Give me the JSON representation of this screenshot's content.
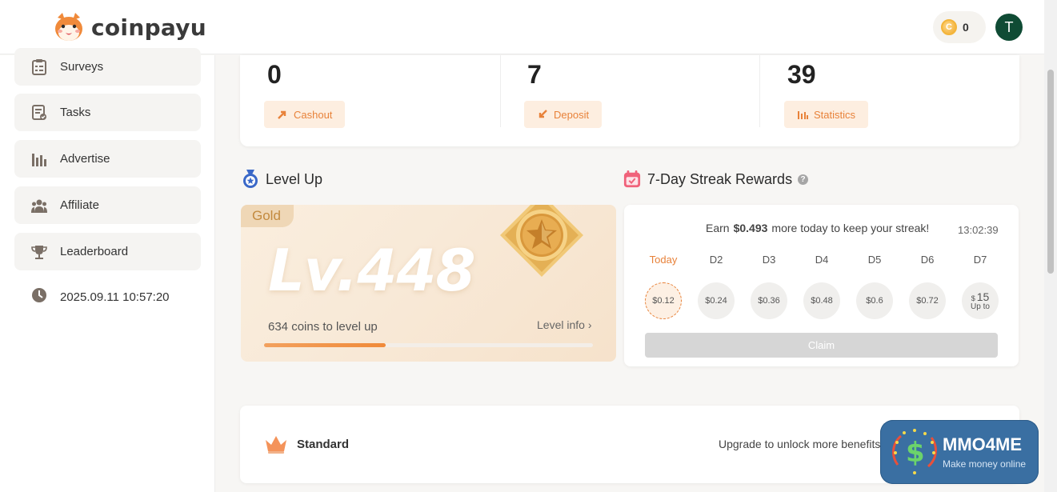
{
  "app": {
    "brand": "coinpayu"
  },
  "header": {
    "coin_symbol": "C",
    "coin_balance": "0",
    "avatar_initial": "T"
  },
  "sidebar": {
    "items": [
      {
        "label": "Surveys",
        "icon": "clipboard-icon"
      },
      {
        "label": "Tasks",
        "icon": "tasks-icon"
      },
      {
        "label": "Advertise",
        "icon": "bar-chart-icon"
      },
      {
        "label": "Affiliate",
        "icon": "users-icon"
      },
      {
        "label": "Leaderboard",
        "icon": "trophy-icon"
      }
    ],
    "datetime": "2025.09.11 10:57:20"
  },
  "stats": [
    {
      "value": "0",
      "button": "Cashout"
    },
    {
      "value": "7",
      "button": "Deposit"
    },
    {
      "value": "39",
      "button": "Statistics"
    }
  ],
  "level": {
    "section_title": "Level Up",
    "tier": "Gold",
    "level_text": "Lv.448",
    "coins_to_level": "634 coins to level up",
    "level_info": "Level info ›",
    "progress": 0.37
  },
  "streak": {
    "section_title": "7-Day Streak Rewards",
    "help": "?",
    "earn_prefix": "Earn",
    "earn_amount": "$0.493",
    "earn_suffix": "more today to keep your streak!",
    "timer": "13:02:39",
    "days": [
      {
        "label": "Today",
        "reward": "$0.12"
      },
      {
        "label": "D2",
        "reward": "$0.24"
      },
      {
        "label": "D3",
        "reward": "$0.36"
      },
      {
        "label": "D4",
        "reward": "$0.48"
      },
      {
        "label": "D5",
        "reward": "$0.6"
      },
      {
        "label": "D6",
        "reward": "$0.72"
      },
      {
        "label": "D7",
        "reward_currency": "$",
        "reward": "15",
        "reward_note": "Up to"
      }
    ],
    "claim": "Claim"
  },
  "membership": {
    "tier": "Standard",
    "upgrade_text": "Upgrade to unlock more benefits"
  },
  "watermark": {
    "title": "MMO4ME",
    "subtitle": "Make money online"
  },
  "colors": {
    "accent": "#e8823a",
    "avatar_bg": "#0f4b34",
    "gold_tag": "#c38a3e"
  }
}
